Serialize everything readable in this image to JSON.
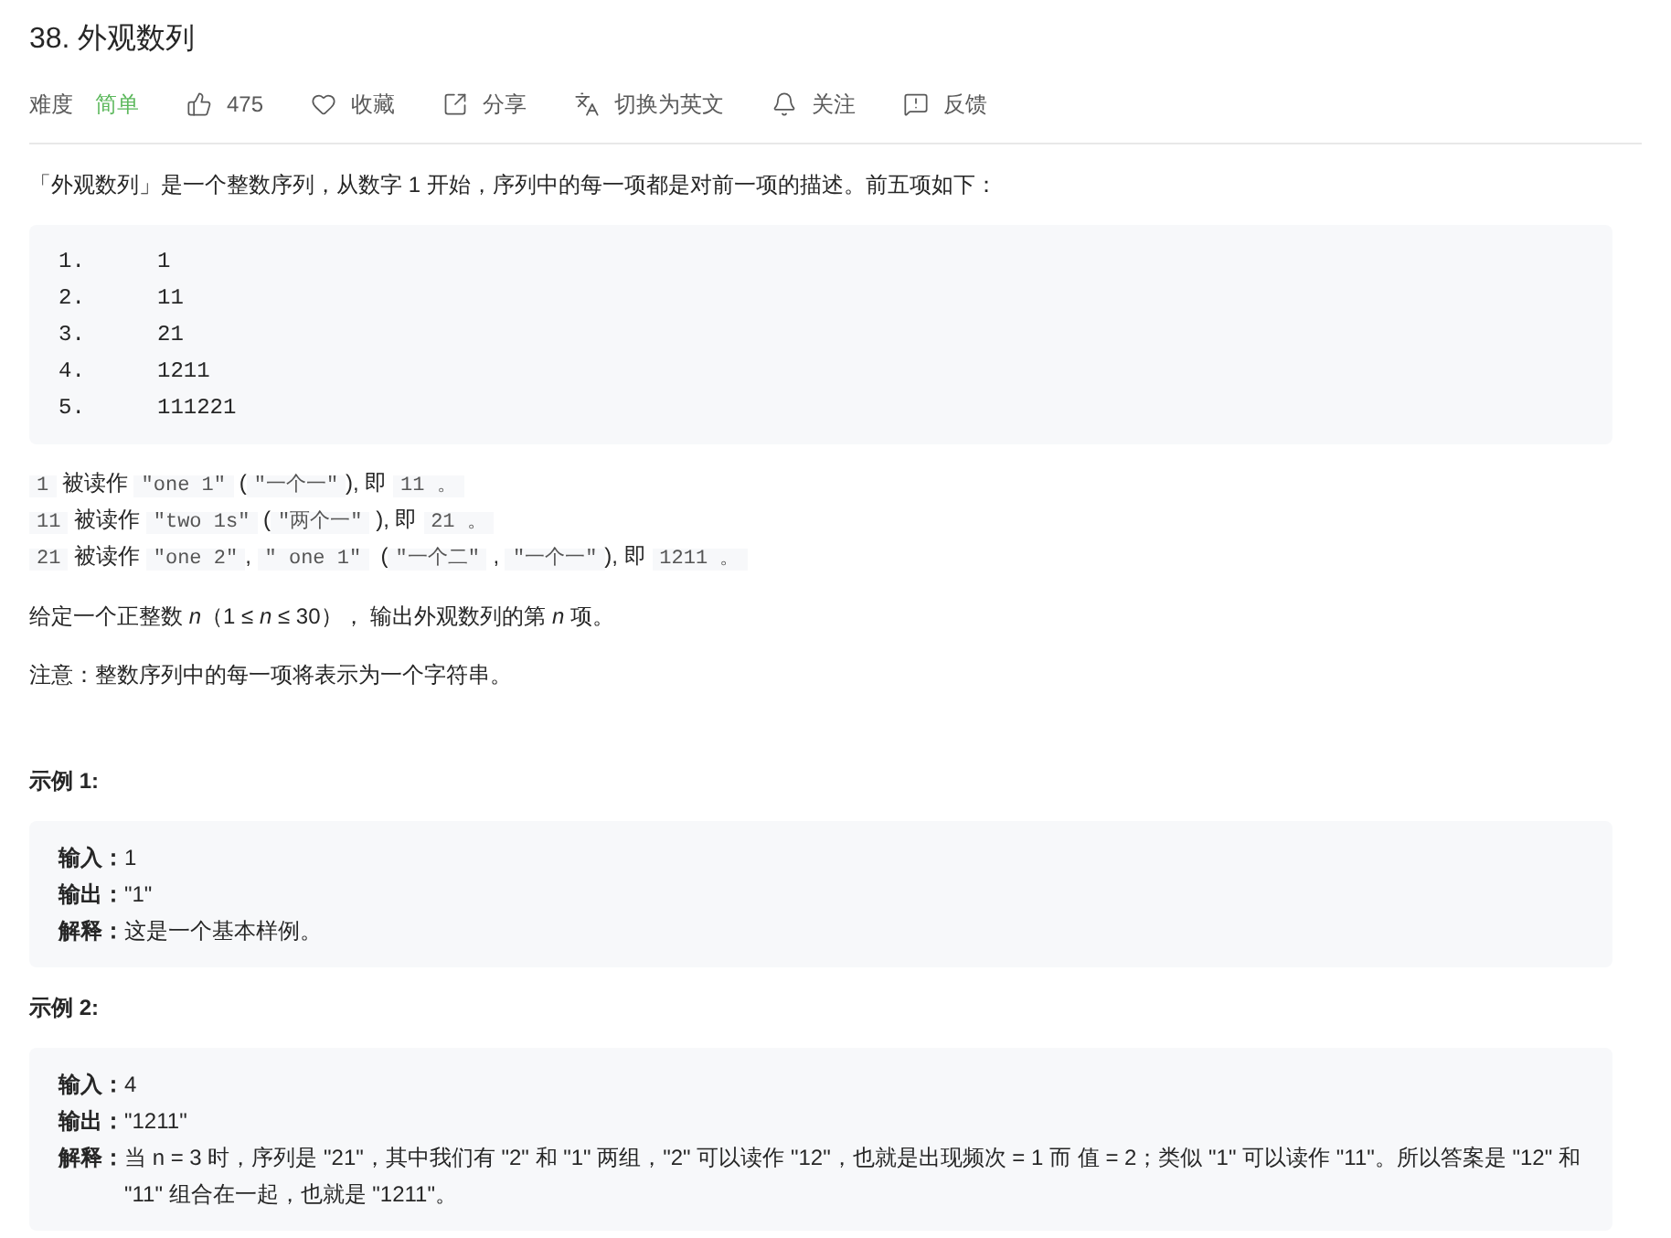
{
  "title": "38. 外观数列",
  "toolbar": {
    "difficulty_label": "难度",
    "difficulty": "简单",
    "actions": [
      {
        "kind": "like",
        "label": "475"
      },
      {
        "kind": "favorite",
        "label": "收藏"
      },
      {
        "kind": "share",
        "label": "分享"
      },
      {
        "kind": "translate",
        "label": "切换为英文"
      },
      {
        "kind": "follow",
        "label": "关注"
      },
      {
        "kind": "feedback",
        "label": "反馈"
      }
    ]
  },
  "intro": "「外观数列」是一个整数序列，从数字 1 开始，序列中的每一项都是对前一项的描述。前五项如下：",
  "sequence": [
    {
      "index": "1.",
      "value": "1"
    },
    {
      "index": "2.",
      "value": "11"
    },
    {
      "index": "3.",
      "value": "21"
    },
    {
      "index": "4.",
      "value": "1211"
    },
    {
      "index": "5.",
      "value": "111221"
    }
  ],
  "readings": [
    [
      {
        "kind": "code",
        "text": "1"
      },
      {
        "kind": "text",
        "text": " 被读作 "
      },
      {
        "kind": "code",
        "text": "\"one 1\""
      },
      {
        "kind": "text",
        "text": " ("
      },
      {
        "kind": "code",
        "text": "\"一个一\""
      },
      {
        "kind": "text",
        "text": "), 即 "
      },
      {
        "kind": "code",
        "text": "11 。"
      }
    ],
    [
      {
        "kind": "code",
        "text": "11"
      },
      {
        "kind": "text",
        "text": " 被读作 "
      },
      {
        "kind": "code",
        "text": "\"two 1s\""
      },
      {
        "kind": "text",
        "text": " ("
      },
      {
        "kind": "code",
        "text": "\"两个一\""
      },
      {
        "kind": "text",
        "text": " ), 即 "
      },
      {
        "kind": "code",
        "text": "21 。"
      }
    ],
    [
      {
        "kind": "code",
        "text": "21"
      },
      {
        "kind": "text",
        "text": " 被读作 "
      },
      {
        "kind": "code",
        "text": "\"one 2\""
      },
      {
        "kind": "text",
        "text": ", "
      },
      {
        "kind": "code",
        "text": "\" one 1\""
      },
      {
        "kind": "text",
        "text": "  ("
      },
      {
        "kind": "code",
        "text": "\"一个二\""
      },
      {
        "kind": "text",
        "text": " , "
      },
      {
        "kind": "code",
        "text": "\"一个一\""
      },
      {
        "kind": "text",
        "text": "), 即 "
      },
      {
        "kind": "code",
        "text": "1211 。"
      }
    ]
  ],
  "task": "给定一个正整数 *n*（1 ≤ *n* ≤ 30）， 输出外观数列的第 *n* 项。",
  "note": "注意：整数序列中的每一项将表示为一个字符串。",
  "examples": [
    {
      "heading": "示例 1:",
      "lines": [
        {
          "label": "输入：",
          "value": "1"
        },
        {
          "label": "输出：",
          "value": "\"1\""
        },
        {
          "label": "解释：",
          "value": "这是一个基本样例。"
        }
      ]
    },
    {
      "heading": "示例 2:",
      "lines": [
        {
          "label": "输入：",
          "value": "4"
        },
        {
          "label": "输出：",
          "value": "\"1211\""
        },
        {
          "label": "解释：",
          "value": "当 n = 3 时，序列是 \"21\"，其中我们有 \"2\" 和 \"1\" 两组，\"2\" 可以读作 \"12\"，也就是出现频次 = 1 而 值 = 2；类似 \"1\" 可以读作 \"11\"。所以答案是 \"12\" 和 \"11\" 组合在一起，也就是 \"1211\"。"
        }
      ]
    }
  ]
}
